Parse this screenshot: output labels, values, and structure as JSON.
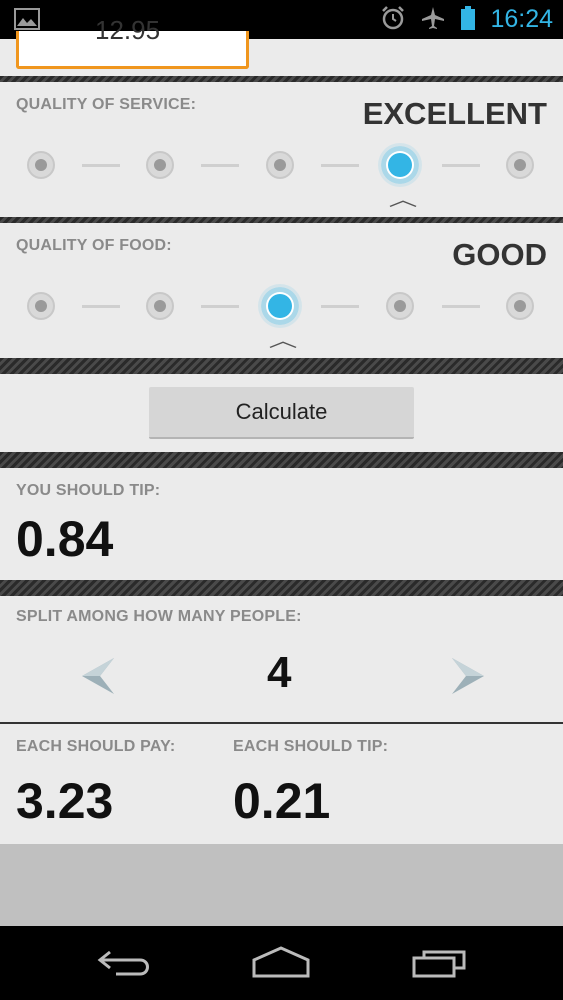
{
  "status_bar": {
    "time": "16:24",
    "icons": [
      "image-notification-icon",
      "alarm-icon",
      "airplane-mode-icon",
      "battery-icon"
    ],
    "accent": "#33b5e5"
  },
  "bill": {
    "value": "12.95"
  },
  "service": {
    "label": "QUALITY OF SERVICE:",
    "rating": "EXCELLENT",
    "levels": 5,
    "selected_level": 4
  },
  "food": {
    "label": "QUALITY OF FOOD:",
    "rating": "GOOD",
    "levels": 5,
    "selected_level": 3
  },
  "calculate": {
    "label": "Calculate"
  },
  "tip": {
    "label": "YOU SHOULD TIP:",
    "value": "0.84"
  },
  "split": {
    "label": "SPLIT AMONG HOW MANY PEOPLE:",
    "people": "4"
  },
  "each": {
    "pay_label": "EACH SHOULD PAY:",
    "pay_value": "3.23",
    "tip_label": "EACH SHOULD TIP:",
    "tip_value": "0.21"
  },
  "nav": {
    "icons": [
      "back-icon",
      "home-icon",
      "recent-apps-icon"
    ]
  }
}
